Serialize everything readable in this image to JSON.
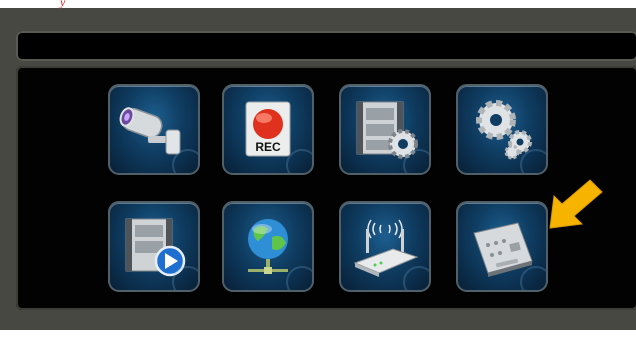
{
  "page": {
    "header_mark": "y",
    "title_bar_text": ""
  },
  "menu": {
    "tiles": [
      {
        "icon": "cctv-camera-icon",
        "caption": ""
      },
      {
        "icon": "record-icon",
        "caption": "REC"
      },
      {
        "icon": "video-settings-icon",
        "caption": ""
      },
      {
        "icon": "gears-icon",
        "caption": ""
      },
      {
        "icon": "video-playback-icon",
        "caption": ""
      },
      {
        "icon": "network-globe-icon",
        "caption": ""
      },
      {
        "icon": "wifi-router-icon",
        "caption": ""
      },
      {
        "icon": "hard-drive-icon",
        "caption": ""
      }
    ]
  },
  "highlight": {
    "icon": "yellow-arrow-icon",
    "color": "#f6b400"
  },
  "colors": {
    "frame": "#484842",
    "panel": "#020202",
    "tile": "#0f3d62",
    "accent": "#f6b400"
  }
}
